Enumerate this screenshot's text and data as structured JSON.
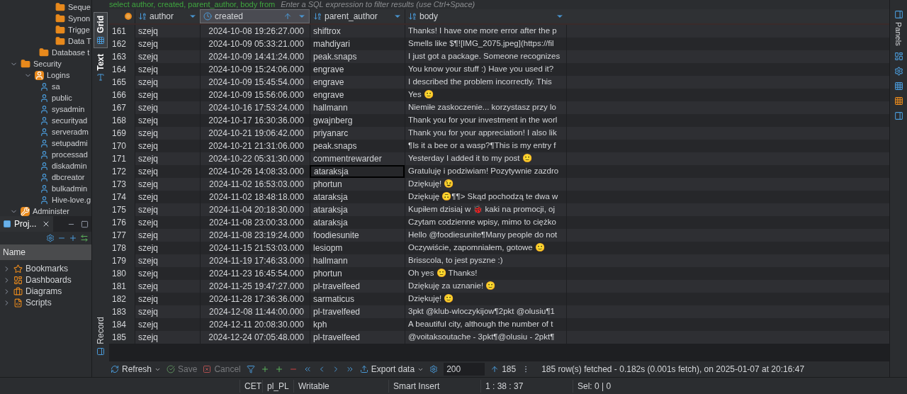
{
  "navigator": {
    "items": [
      {
        "label": "Seque",
        "kind": "folder"
      },
      {
        "label": "Synon",
        "kind": "folder"
      },
      {
        "label": "Trigge",
        "kind": "folder"
      },
      {
        "label": "Data T",
        "kind": "folder"
      },
      {
        "label": "Database t",
        "kind": "folder-outer"
      },
      {
        "label": "Security",
        "kind": "folder-root",
        "expanded": true,
        "children": [
          {
            "label": "Logins",
            "kind": "logins",
            "expanded": true,
            "children": [
              {
                "label": "sa",
                "kind": "user"
              },
              {
                "label": "public",
                "kind": "user"
              },
              {
                "label": "sysadmin",
                "kind": "user"
              },
              {
                "label": "securityad",
                "kind": "user"
              },
              {
                "label": "serveradm",
                "kind": "user"
              },
              {
                "label": "setupadmi",
                "kind": "user"
              },
              {
                "label": "processad",
                "kind": "user"
              },
              {
                "label": "diskadmin",
                "kind": "user"
              },
              {
                "label": "dbcreator",
                "kind": "user"
              },
              {
                "label": "bulkadmin",
                "kind": "user"
              },
              {
                "label": "Hive-love.g",
                "kind": "user"
              }
            ]
          }
        ]
      },
      {
        "label": "Administer",
        "kind": "admin",
        "expanded": true
      }
    ]
  },
  "projects": {
    "tab": "Proj...",
    "column": "Name",
    "items": [
      {
        "label": "Bookmarks",
        "kind": "bookmarks",
        "expanded": false
      },
      {
        "label": "Dashboards",
        "kind": "dashboards",
        "expanded": false
      },
      {
        "label": "Diagrams",
        "kind": "diagrams",
        "expanded": false
      },
      {
        "label": "Scripts",
        "kind": "scripts",
        "expanded": false
      }
    ]
  },
  "query": {
    "sql": "select author, created, parent_author, body from",
    "filter_placeholder": "Enter a SQL expression to filter results (use Ctrl+Space)"
  },
  "view_tabs": [
    {
      "label": "Grid",
      "selected": true
    },
    {
      "label": "Text",
      "selected": false
    }
  ],
  "record_tab": "Record",
  "table": {
    "columns": [
      {
        "label": "author",
        "kind": "text",
        "sorted": false
      },
      {
        "label": "created",
        "kind": "date",
        "sorted": true
      },
      {
        "label": "parent_author",
        "kind": "text",
        "sorted": false
      },
      {
        "label": "body",
        "kind": "text",
        "sorted": false
      }
    ],
    "rows": [
      {
        "n": "161",
        "author": "szejq",
        "created": "2024-10-08 19:26:27.000",
        "parent_author": "shiftrox",
        "body": "Thanks! I have one more error after the p",
        "focused": false
      },
      {
        "n": "162",
        "author": "szejq",
        "created": "2024-10-09 05:33:21.000",
        "parent_author": "mahdiyari",
        "body": "Smells like $¶![IMG_2075.jpeg](https://fil",
        "focused": false
      },
      {
        "n": "163",
        "author": "szejq",
        "created": "2024-10-09 14:41:24.000",
        "parent_author": "peak.snaps",
        "body": "I just got a package. Someone recognizes",
        "focused": false
      },
      {
        "n": "164",
        "author": "szejq",
        "created": "2024-10-09 15:24:06.000",
        "parent_author": "engrave",
        "body": "You know your stuff :) Have you used it?",
        "focused": false
      },
      {
        "n": "165",
        "author": "szejq",
        "created": "2024-10-09 15:45:54.000",
        "parent_author": "engrave",
        "body": "I described the problem incorrectly. This",
        "focused": false
      },
      {
        "n": "166",
        "author": "szejq",
        "created": "2024-10-09 15:56:06.000",
        "parent_author": "engrave",
        "body": "Yes 🙂",
        "focused": false
      },
      {
        "n": "167",
        "author": "szejq",
        "created": "2024-10-16 17:53:24.000",
        "parent_author": "hallmann",
        "body": "Niemiłe zaskoczenie... korzystasz przy lo",
        "focused": false
      },
      {
        "n": "168",
        "author": "szejq",
        "created": "2024-10-17 16:30:36.000",
        "parent_author": "gwajnberg",
        "body": "Thank you for your investment in the worl",
        "focused": false
      },
      {
        "n": "169",
        "author": "szejq",
        "created": "2024-10-21 19:06:42.000",
        "parent_author": "priyanarc",
        "body": "Thank you for your appreciation! I also lik",
        "focused": false
      },
      {
        "n": "170",
        "author": "szejq",
        "created": "2024-10-21 21:31:06.000",
        "parent_author": "peak.snaps",
        "body": "¶Is it a bee or a wasp?¶This is my entry f",
        "focused": false
      },
      {
        "n": "171",
        "author": "szejq",
        "created": "2024-10-22 05:31:30.000",
        "parent_author": "commentrewarder",
        "body": "Yesterday I added it to my post 🙂",
        "focused": false
      },
      {
        "n": "172",
        "author": "szejq",
        "created": "2024-10-26 14:08:33.000",
        "parent_author": "ataraksja",
        "body": "Gratuluję i podziwiam! Pozytywnie zazdro",
        "focused": true
      },
      {
        "n": "173",
        "author": "szejq",
        "created": "2024-11-02 16:53:03.000",
        "parent_author": "phortun",
        "body": "Dziękuję! 😉",
        "focused": false
      },
      {
        "n": "174",
        "author": "szejq",
        "created": "2024-11-02 18:48:18.000",
        "parent_author": "ataraksja",
        "body": "Dziękuję 🙃¶¶> Skąd pochodzą te dwa w",
        "focused": false
      },
      {
        "n": "175",
        "author": "szejq",
        "created": "2024-11-04 20:18:30.000",
        "parent_author": "ataraksja",
        "body": "Kupiłem dzisiaj w 🐞 kaki na promocji, oj",
        "focused": false
      },
      {
        "n": "176",
        "author": "szejq",
        "created": "2024-11-08 23:00:33.000",
        "parent_author": "ataraksja",
        "body": "Czytam codzienne wpisy, mimo to ciężko",
        "focused": false
      },
      {
        "n": "177",
        "author": "szejq",
        "created": "2024-11-08 23:19:24.000",
        "parent_author": "foodiesunite",
        "body": "Hello @foodiesunite¶Many people do not",
        "focused": false
      },
      {
        "n": "178",
        "author": "szejq",
        "created": "2024-11-15 21:53:03.000",
        "parent_author": "lesiopm",
        "body": "Oczywiście, zapomniałem, gotowe 🙂",
        "focused": false
      },
      {
        "n": "179",
        "author": "szejq",
        "created": "2024-11-19 17:46:33.000",
        "parent_author": "hallmann",
        "body": "Brisscola, to jest pyszne :)",
        "focused": false
      },
      {
        "n": "180",
        "author": "szejq",
        "created": "2024-11-23 16:45:54.000",
        "parent_author": "phortun",
        "body": "Oh yes 🙂 Thanks!",
        "focused": false
      },
      {
        "n": "181",
        "author": "szejq",
        "created": "2024-11-25 19:47:27.000",
        "parent_author": "pl-travelfeed",
        "body": "Dziękuję za uznanie! 🙂",
        "focused": false
      },
      {
        "n": "182",
        "author": "szejq",
        "created": "2024-11-28 17:36:36.000",
        "parent_author": "sarmaticus",
        "body": "Dziękuję! 🙂",
        "focused": false
      },
      {
        "n": "183",
        "author": "szejq",
        "created": "2024-12-08 11:44:00.000",
        "parent_author": "pl-travelfeed",
        "body": "3pkt @klub-wloczykijow¶2pkt @olusiu¶1",
        "focused": false
      },
      {
        "n": "184",
        "author": "szejq",
        "created": "2024-12-11 20:08:30.000",
        "parent_author": "kph",
        "body": "A beautiful city, although the number of t",
        "focused": false
      },
      {
        "n": "185",
        "author": "szejq",
        "created": "2024-12-24 07:05:48.000",
        "parent_author": "pl-travelfeed",
        "body": "@voitaksoutache - 3pkt¶@olusiu - 2pkt¶",
        "focused": false
      }
    ]
  },
  "toolbar": {
    "refresh": "Refresh",
    "save": "Save",
    "cancel": "Cancel",
    "export": "Export data",
    "fetch_size": "200",
    "row_count": "185",
    "message": "185 row(s) fetched - 0.182s (0.001s fetch), on 2025-01-07 at 20:16:47"
  },
  "panels_tab": "Panels",
  "status_bar": [
    "CET",
    "pl_PL",
    "Writable",
    "Smart Insert",
    "1 : 38 : 37",
    "Sel: 0 | 0"
  ]
}
